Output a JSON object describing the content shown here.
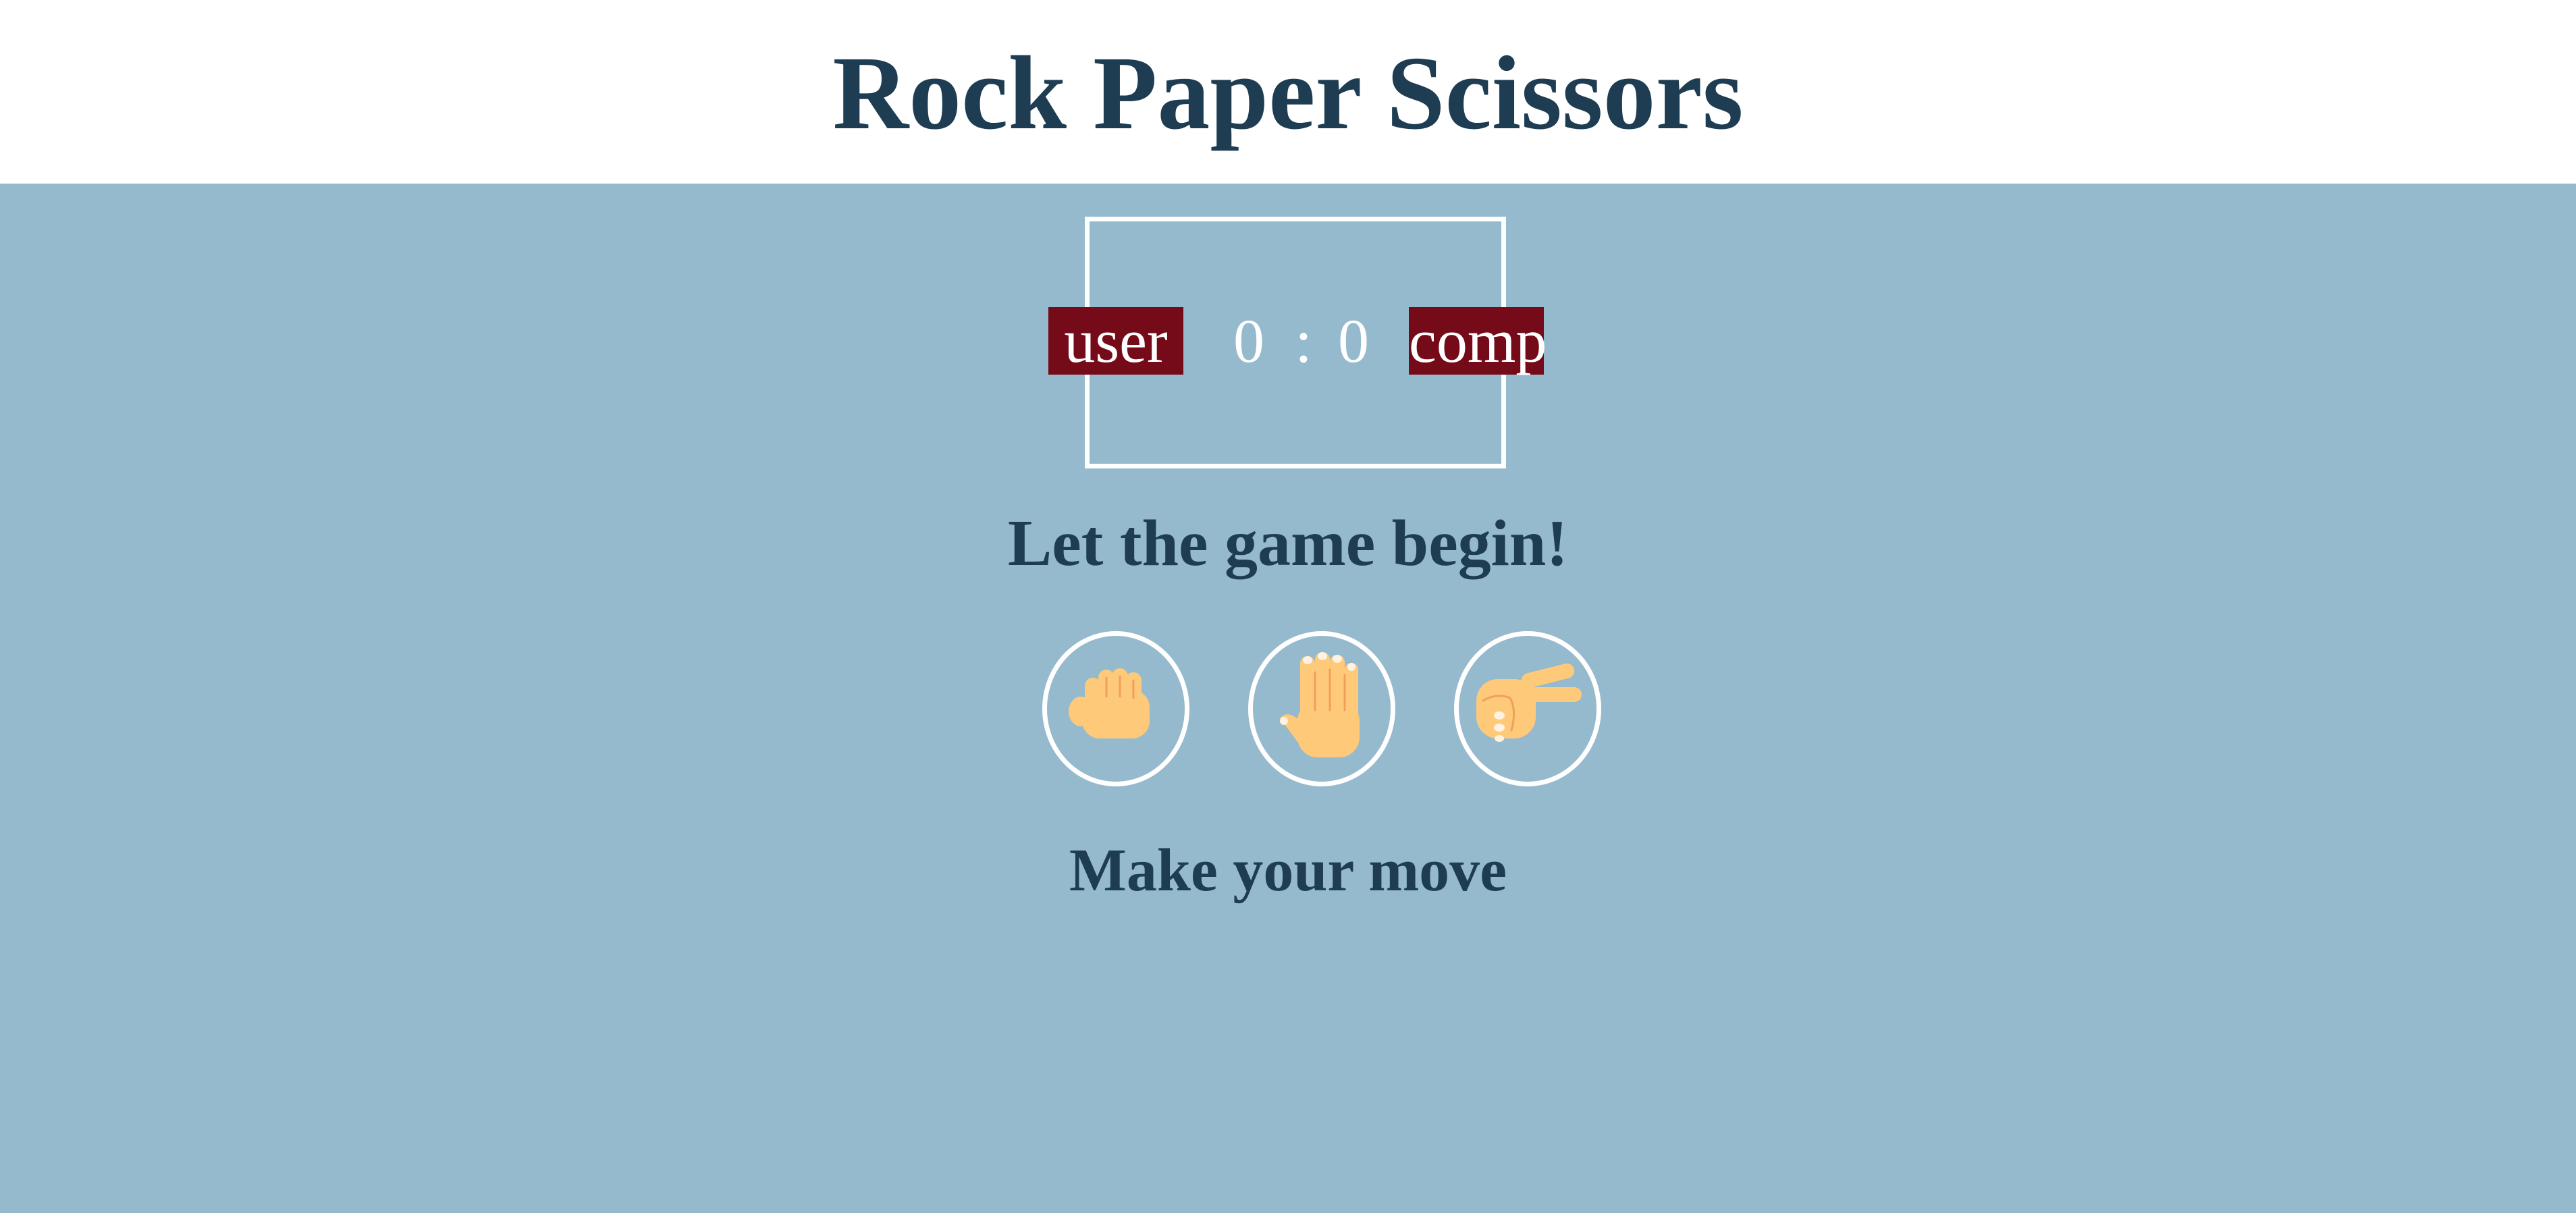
{
  "header": {
    "title": "Rock Paper Scissors"
  },
  "scoreboard": {
    "user_label": "user",
    "comp_label": "comp",
    "user_score": "0",
    "separator": ":",
    "comp_score": "0"
  },
  "result_message": "Let the game begin!",
  "choices": [
    {
      "id": "rock",
      "icon": "rock-hand-icon"
    },
    {
      "id": "paper",
      "icon": "paper-hand-icon"
    },
    {
      "id": "scissors",
      "icon": "scissors-hand-icon"
    }
  ],
  "action_message": "Make your move",
  "colors": {
    "background": "#96bacd",
    "header_background": "#ffffff",
    "title_text": "#1e3d52",
    "badge": "#750b18",
    "skin": "#ffc97a",
    "skin_shade": "#f0a05a",
    "outline": "#ffffff"
  }
}
